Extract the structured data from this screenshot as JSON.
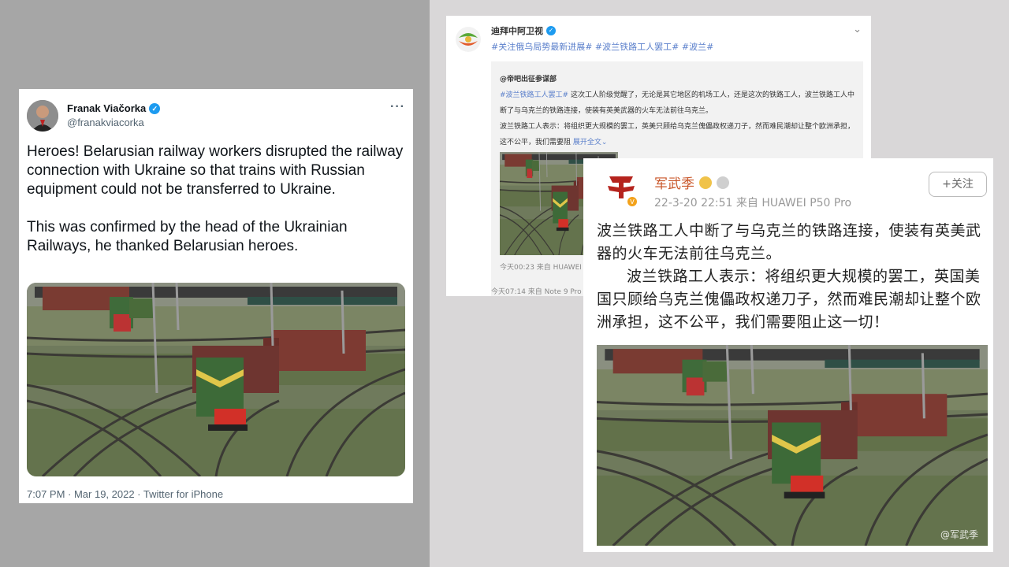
{
  "twitter": {
    "display_name": "Franak Viačorka",
    "handle": "@franakviacorka",
    "more_label": "···",
    "text_para1": "Heroes! Belarusian railway workers disrupted the railway connection with Ukraine so that trains with Russian equipment could not be transferred to Ukraine.",
    "text_para2": "This was confirmed by the head of the Ukrainian Railways, he thanked Belarusian heroes.",
    "timestamp": "7:07 PM · Mar 19, 2022 · Twitter for iPhone"
  },
  "weibo_post_1": {
    "account_name": "迪拜中阿卫视",
    "tags": "#关注俄乌局势最新进展# #波兰铁路工人罢工# #波兰#",
    "quoted": {
      "author": "@帝吧出征参谋部",
      "hashtag": "#波兰铁路工人罢工#",
      "text_line1": "这次工人阶级觉醒了，无论是其它地区的机场工人，还是这次的铁路工人，波兰铁路工人中断了与乌克兰的铁路连接，使装有英美武器的火车无法前往乌克兰。",
      "text_line2": "波兰铁路工人表示：将组织更大规模的罢工，英美只顾给乌克兰傀儡政权递刀子，然而难民潮却让整个欧洲承担，这不公平，我们需要阻",
      "expand_label": "展开全文⌄",
      "meta": "今天00:23 来自 HUAWEI"
    },
    "meta": "今天07:14 来自 Note 9 Pro"
  },
  "weibo_post_2": {
    "account_name": "军武季",
    "timestamp": "22-3-20 22:51  来自 HUAWEI P50 Pro",
    "follow_label": "+关注",
    "text_para1": "波兰铁路工人中断了与乌克兰的铁路连接，使装有英美武器的火车无法前往乌克兰。",
    "text_para2": "波兰铁路工人表示：将组织更大规模的罢工，英国美国只顾给乌克兰傀儡政权递刀子，然而难民潮却让整个欧洲承担，这不公平，我们需要阻止这一切！",
    "watermark": "@军武季"
  },
  "colors": {
    "twitter_blue": "#1d9bf0",
    "weibo_link": "#5a7fcb",
    "weibo_name_orange": "#c9572a",
    "left_background": "#a6a6a6",
    "right_background": "#d9d7d8"
  }
}
